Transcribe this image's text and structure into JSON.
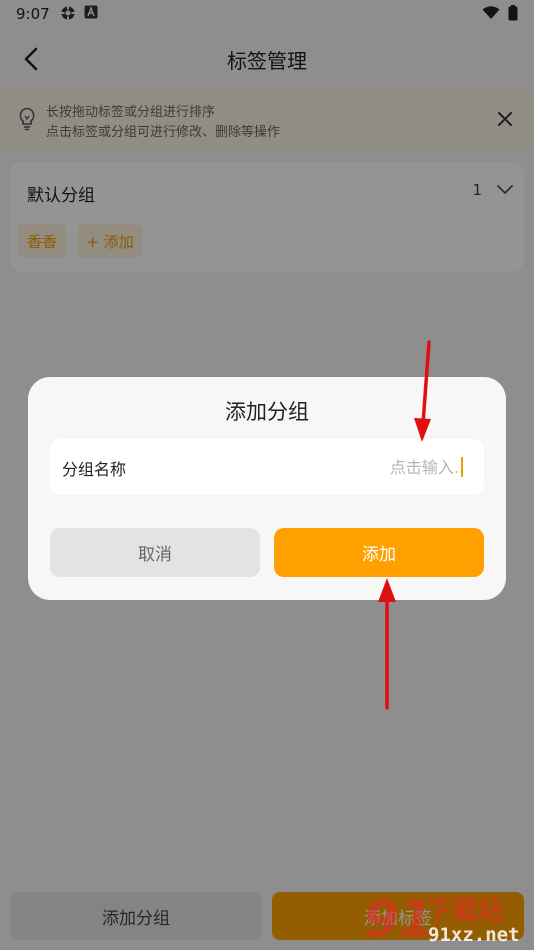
{
  "status_bar": {
    "time": "9:07",
    "left_icons": [
      "settings-gear-icon",
      "a-box-icon"
    ],
    "right_icons": [
      "wifi-icon",
      "battery-icon"
    ]
  },
  "app_bar": {
    "title": "标签管理",
    "back_icon": "chevron-left-icon"
  },
  "tip": {
    "line1": "长按拖动标签或分组进行排序",
    "line2": "点击标签或分组可进行修改、删除等操作",
    "icon": "lightbulb-icon",
    "close_icon": "close-icon"
  },
  "group": {
    "name": "默认分组",
    "count": "1",
    "tags": [
      "香香"
    ],
    "add_tag_label": "+ 添加"
  },
  "bottom": {
    "add_group_label": "添加分组",
    "add_tag_label": "添加标签"
  },
  "dialog": {
    "title": "添加分组",
    "field_label": "分组名称",
    "field_placeholder": "点击输入..",
    "field_value": "",
    "cancel_label": "取消",
    "confirm_label": "添加"
  },
  "watermark": {
    "logo": "91",
    "text": "下载站",
    "url": "91xz.net"
  },
  "colors": {
    "accent": "#ffa000",
    "tip_bg": "#fbf3e4",
    "chip_bg": "#fdf1dc",
    "annotation_arrow": "#e01010"
  }
}
